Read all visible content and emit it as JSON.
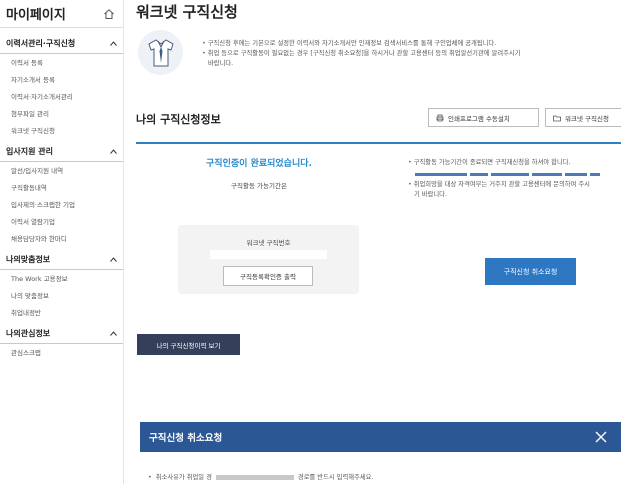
{
  "sidebar": {
    "title": "마이페이지",
    "sections": [
      {
        "title": "이력서관리·구직신청",
        "items": [
          "이력서 등록",
          "자기소개서 등록",
          "이력서·자기소개서관리",
          "첨부파일 관리",
          "워크넷 구직신청"
        ]
      },
      {
        "title": "입사지원 관리",
        "items": [
          "알선/입사지원 내역",
          "구직활동내역",
          "입사제의·스크랩한 기업",
          "이력서 열람기업",
          "채용담당자와 한마디"
        ]
      },
      {
        "title": "나의맞춤정보",
        "items": [
          "The Work 고용정보",
          "나의 맞춤정보",
          "취업내정반"
        ]
      },
      {
        "title": "나의관심정보",
        "items": [
          "관심스크랩"
        ]
      }
    ]
  },
  "page": {
    "title": "워크넷 구직신청"
  },
  "notice": {
    "line1": "구직신청 후에는 기본으로 설정한 이력서와 자기소개서만 인재정보 검색서비스를 통해 구인업체에 공개됩니다.",
    "line2": "취업 등으로 구직활동이 필요없는 경우 [구직신청 취소요청]을 하시거나 관할 고용센터 등의 취업알선기관에 알려주시기",
    "line3": "바랍니다."
  },
  "section": {
    "title": "나의 구직신청정보",
    "print_btn": "인쇄프로그램 수동설치",
    "worknet_btn": "워크넷 구직신청"
  },
  "status": {
    "title": "구직인증이 완료되었습니다.",
    "period_label": "구직활동 가능기간은"
  },
  "worknet_box": {
    "label": "워크넷 구직번호",
    "print_cert_btn": "구직등록확인증 출력"
  },
  "right_notes": {
    "line1": "구직활동 가능기간이 종료되면 구직재신청을 하셔야 합니다.",
    "line2": "취업희망을 대상 자격여부는 거주지 관할 고용센터에 문의하여 주시",
    "line3": "기 바랍니다."
  },
  "cancel_request_btn": "구직신청 취소요청",
  "history_btn": "나의 구직신청이력 보기",
  "modal": {
    "title": "구직신청 취소요청",
    "line_start": "취소사유가 취업일 경",
    "line_end": "경로를 반드시 입력해주세요."
  },
  "colors": {
    "accent": "#2f7fc1",
    "status_blue": "#2a8bd1",
    "cancel_btn": "#2e77c2",
    "history_btn": "#34405a",
    "modal_header": "#2c5795"
  }
}
